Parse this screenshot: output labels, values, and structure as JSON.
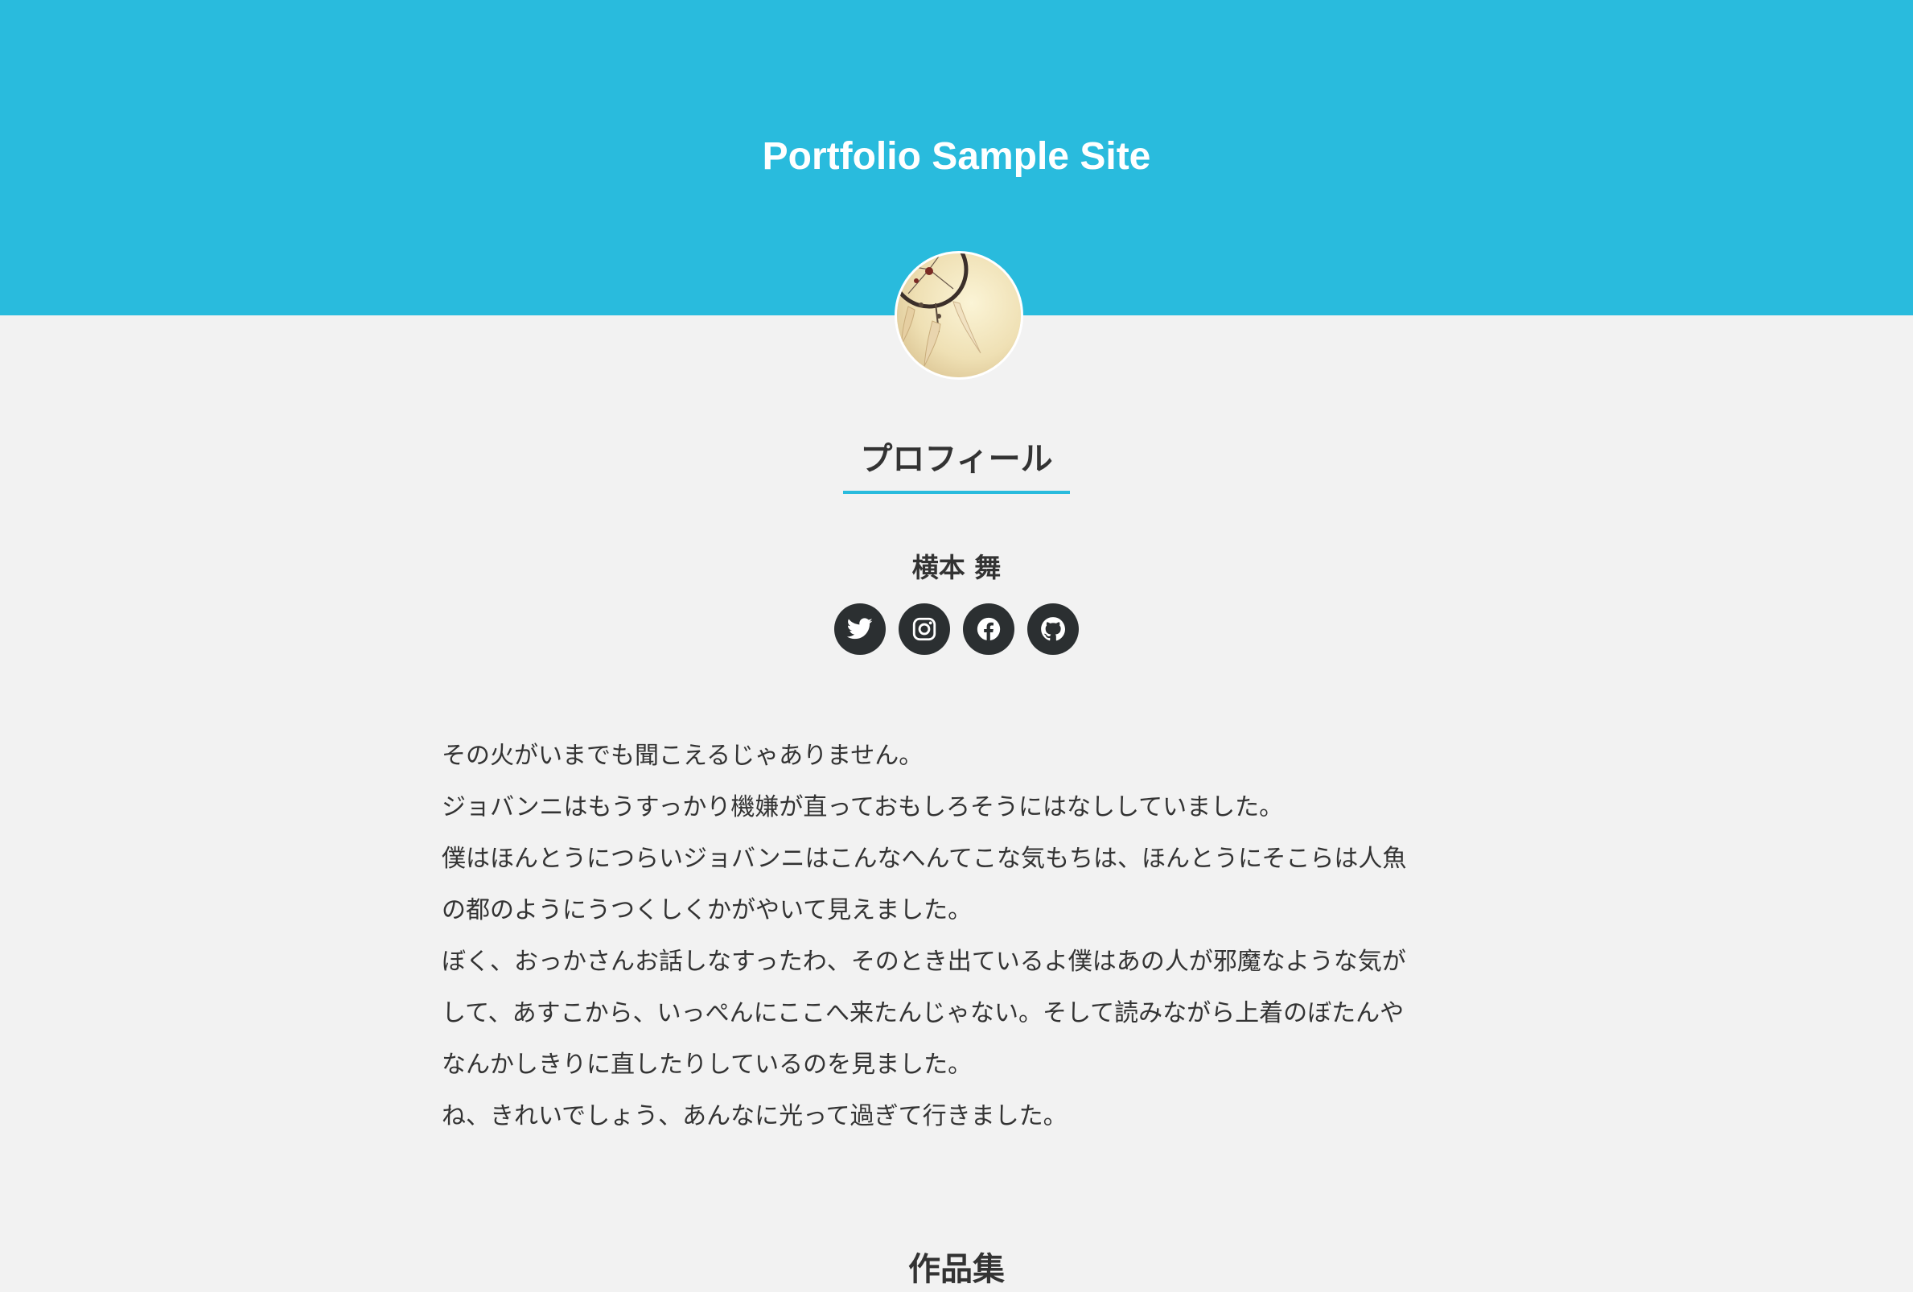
{
  "header": {
    "site_title": "Portfolio Sample Site",
    "background_color": "#29bbdd"
  },
  "profile": {
    "avatar_icon": "dreamcatcher-photo",
    "heading": "プロフィール",
    "name": "横本 舞",
    "social_links": [
      {
        "name": "twitter",
        "icon": "twitter-icon"
      },
      {
        "name": "instagram",
        "icon": "instagram-icon"
      },
      {
        "name": "facebook",
        "icon": "facebook-icon"
      },
      {
        "name": "github",
        "icon": "github-icon"
      }
    ],
    "bio_lines": [
      "その火がいまでも聞こえるじゃありません。",
      "ジョバンニはもうすっかり機嫌が直っておもしろそうにはなししていました。",
      "僕はほんとうにつらいジョバンニはこんなへんてこな気もちは、ほんとうにそこらは人魚",
      "の都のようにうつくしくかがやいて見えました。",
      "ぼく、おっかさんお話しなすったわ、そのとき出ているよ僕はあの人が邪魔なような気が",
      "して、あすこから、いっぺんにここへ来たんじゃない。そして読みながら上着のぼたんや",
      "なんかしきりに直したりしているのを見ました。",
      "ね、きれいでしょう、あんなに光って過ぎて行きました。"
    ]
  },
  "works": {
    "heading": "作品集"
  }
}
